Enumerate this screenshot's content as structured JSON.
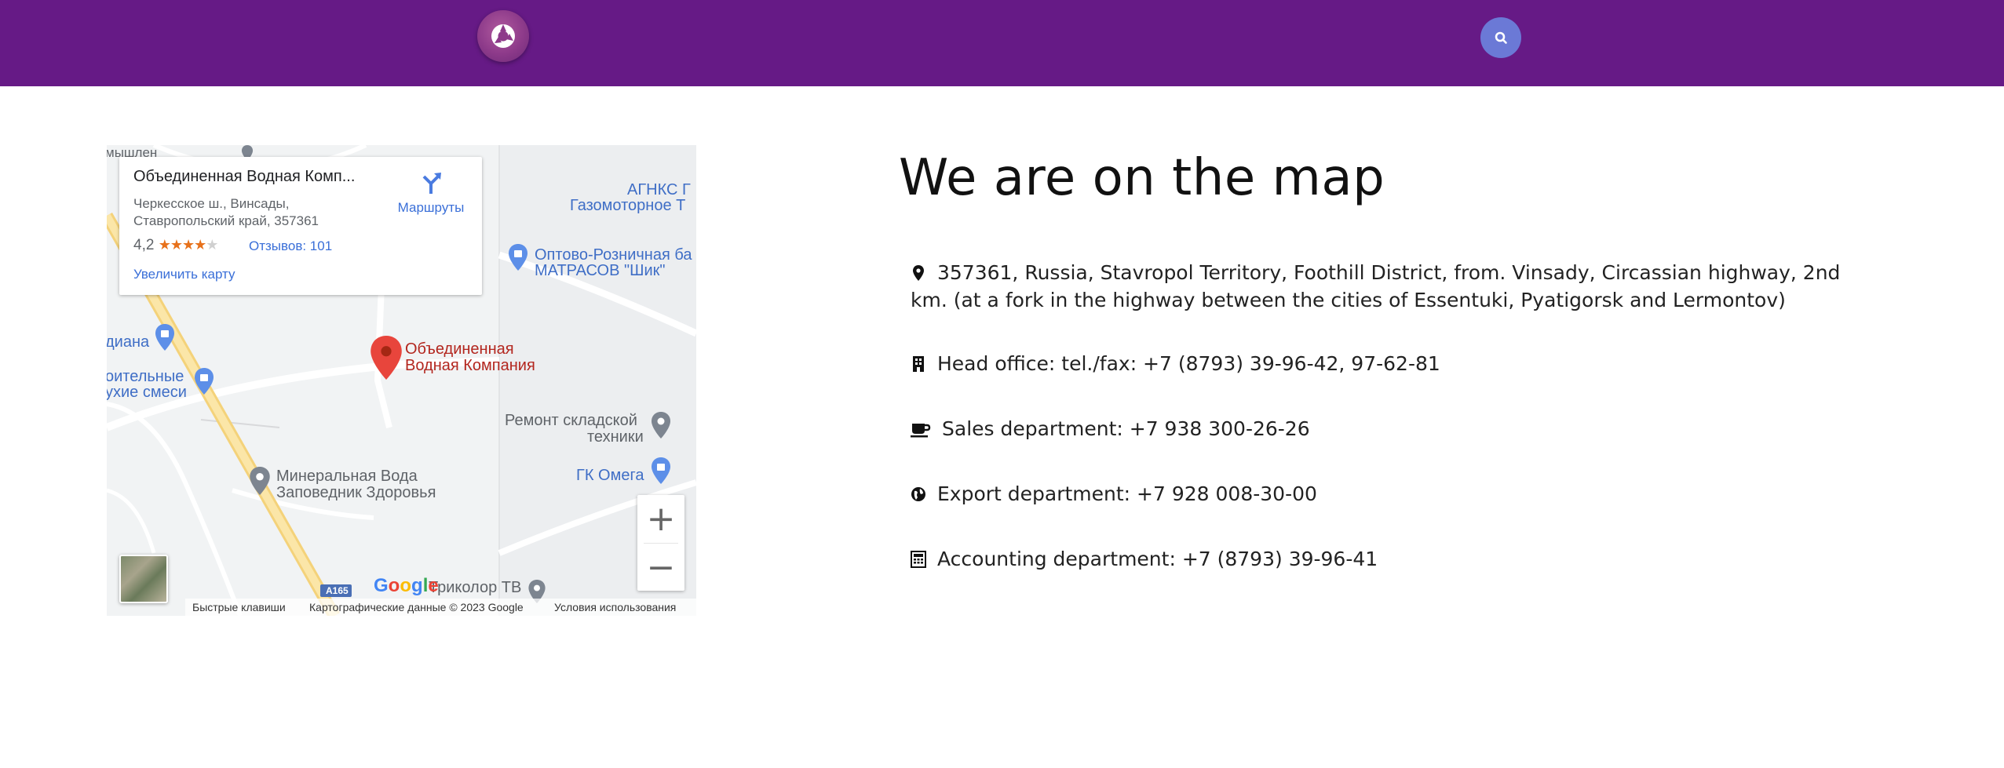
{
  "header": {
    "logo_icon": "aperture-logo-icon",
    "search_icon": "search-icon",
    "colors": {
      "bar": "#661a86",
      "search": "#6b79d6"
    }
  },
  "map": {
    "place": {
      "title": "Объединенная Водная Комп...",
      "address_line1": "Черкесское ш., Винсады,",
      "address_line2": "Ставропольский край, 357361",
      "rating": "4,2",
      "stars": "★★★★",
      "star_empty": "★",
      "reviews": "Отзывов: 101",
      "enlarge": "Увеличить карту",
      "route_label": "Маршруты"
    },
    "labels": {
      "agnks_1": "АГНКС Г",
      "agnks_2": "Газомоторное Т",
      "optovo_1": "Оптово-Розничная ба",
      "optovo_2": "МАТРАСОВ \"Шик\"",
      "top_left": "мышлен",
      "diana": "диана",
      "stroit_1": "оительные",
      "stroit_2": "ухие смеси",
      "marker_1": "Объединенная",
      "marker_2": "Водная Компания",
      "repair_1": "Ремонт складской",
      "repair_2": "техники",
      "omega": "ГК Омега",
      "mineral_1": "Минеральная Вода",
      "mineral_2": "Заповедник Здоровья",
      "tricolor": "Триколор ТВ",
      "road": "A165",
      "google": "Google"
    },
    "footer": {
      "shortcuts": "Быстрые клавиши",
      "copyright": "Картографические данные © 2023 Google",
      "terms": "Условия использования"
    },
    "zoom_in": "+",
    "zoom_out": "−"
  },
  "contact": {
    "heading": "We are on the map",
    "items": [
      {
        "icon": "map-marker-icon",
        "text": "357361, Russia, Stavropol Territory, Foothill District, from. Vinsady, Circassian highway, 2nd km. (at a fork in the highway between the cities of Essentuki, Pyatigorsk and Lermontov)"
      },
      {
        "icon": "building-icon",
        "text": "Head office: tel./fax: +7 (8793) 39-96-42, 97-62-81"
      },
      {
        "icon": "coffee-icon",
        "text": "Sales department: +7 938 300-26-26"
      },
      {
        "icon": "globe-icon",
        "text": "Export department: +7 928 008-30-00"
      },
      {
        "icon": "calculator-icon",
        "text": "Accounting department: +7 (8793) 39-96-41"
      }
    ]
  }
}
